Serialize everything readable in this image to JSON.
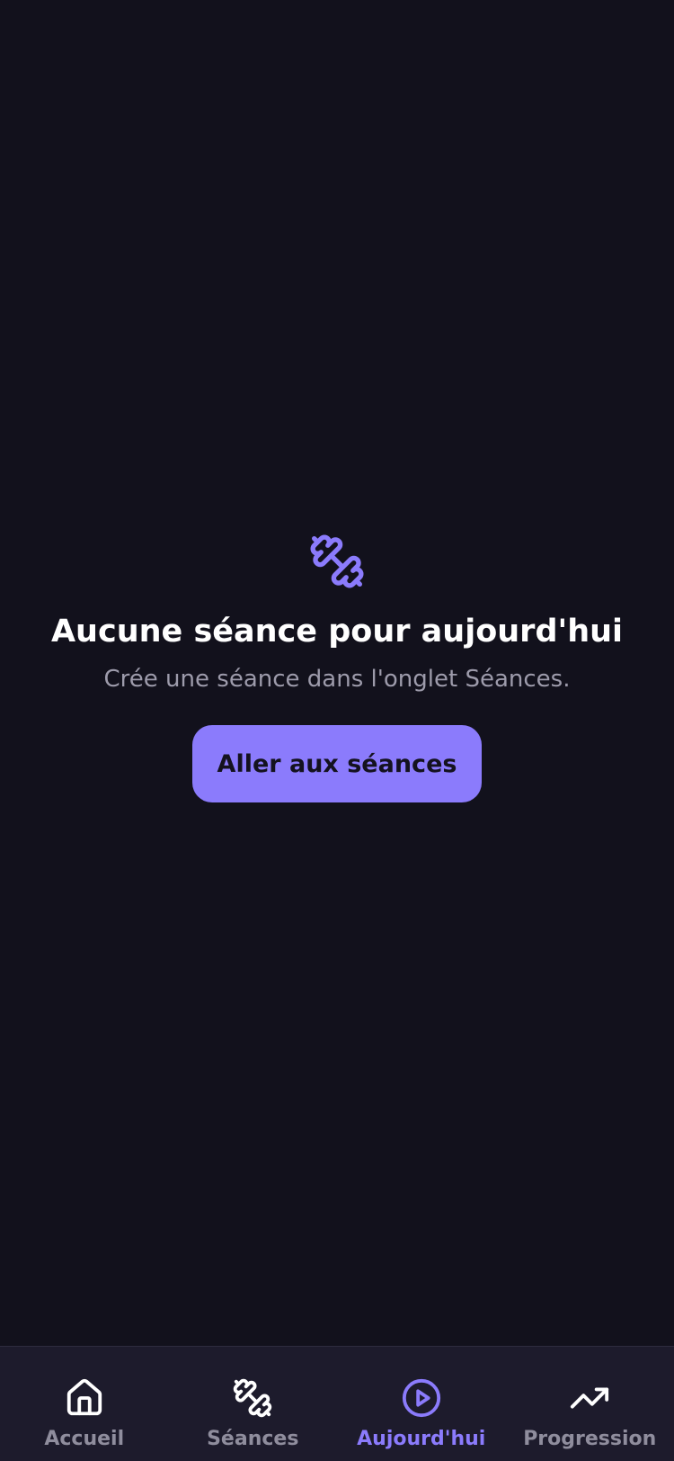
{
  "colors": {
    "background": "#12111c",
    "tabbar_background": "#1d1b2c",
    "accent": "#8b7bfc",
    "text_primary": "#ffffff",
    "text_secondary": "#9d9bab",
    "tab_inactive": "#8f8d9d"
  },
  "empty_state": {
    "icon": "dumbbell-icon",
    "title": "Aucune séance pour aujourd'hui",
    "subtitle": "Crée une séance dans l'onglet Séances.",
    "button_label": "Aller aux séances"
  },
  "tabbar": {
    "active_tab": "Aujourd'hui",
    "tabs": [
      {
        "label": "Accueil",
        "icon": "home-icon"
      },
      {
        "label": "Séances",
        "icon": "dumbbell-icon"
      },
      {
        "label": "Aujourd'hui",
        "icon": "play-circle-icon"
      },
      {
        "label": "Progression",
        "icon": "trending-up-icon"
      }
    ]
  }
}
